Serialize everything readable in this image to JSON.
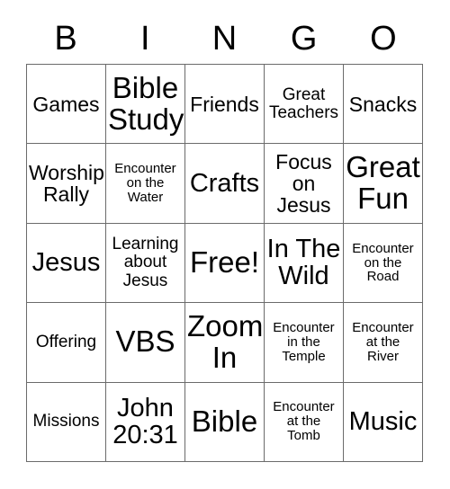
{
  "page": {
    "title": "BINGO Card",
    "background_color": "#ffffff",
    "text_color": "#000000",
    "grid_line_color": "#6b6b6b"
  },
  "header": {
    "letters": [
      "B",
      "I",
      "N",
      "G",
      "O"
    ]
  },
  "grid": {
    "columns": 5,
    "rows": 5,
    "free_space": {
      "row": 2,
      "column": 2,
      "label": "Free!"
    },
    "cells": [
      [
        {
          "text": "Games",
          "size": "sz-md"
        },
        {
          "text": "Bible\nStudy",
          "size": "sz-xl"
        },
        {
          "text": "Friends",
          "size": "sz-md"
        },
        {
          "text": "Great\nTeachers",
          "size": "sz-sm"
        },
        {
          "text": "Snacks",
          "size": "sz-md"
        }
      ],
      [
        {
          "text": "Worship\nRally",
          "size": "sz-md"
        },
        {
          "text": "Encounter\non the\nWater",
          "size": "sz-xs"
        },
        {
          "text": "Crafts",
          "size": "sz-lg"
        },
        {
          "text": "Focus\non\nJesus",
          "size": "sz-md"
        },
        {
          "text": "Great\nFun",
          "size": "sz-xl"
        }
      ],
      [
        {
          "text": "Jesus",
          "size": "sz-lg"
        },
        {
          "text": "Learning\nabout\nJesus",
          "size": "sz-sm"
        },
        {
          "text": "Free!",
          "size": "sz-xl"
        },
        {
          "text": "In The\nWild",
          "size": "sz-lg"
        },
        {
          "text": "Encounter\non the\nRoad",
          "size": "sz-xs"
        }
      ],
      [
        {
          "text": "Offering",
          "size": "sz-sm"
        },
        {
          "text": "VBS",
          "size": "sz-xl"
        },
        {
          "text": "Zoom\nIn",
          "size": "sz-xl"
        },
        {
          "text": "Encounter\nin the\nTemple",
          "size": "sz-xs"
        },
        {
          "text": "Encounter\nat the\nRiver",
          "size": "sz-xs"
        }
      ],
      [
        {
          "text": "Missions",
          "size": "sz-sm"
        },
        {
          "text": "John\n20:31",
          "size": "sz-lg"
        },
        {
          "text": "Bible",
          "size": "sz-xl"
        },
        {
          "text": "Encounter\nat the\nTomb",
          "size": "sz-xs"
        },
        {
          "text": "Music",
          "size": "sz-lg"
        }
      ]
    ]
  }
}
